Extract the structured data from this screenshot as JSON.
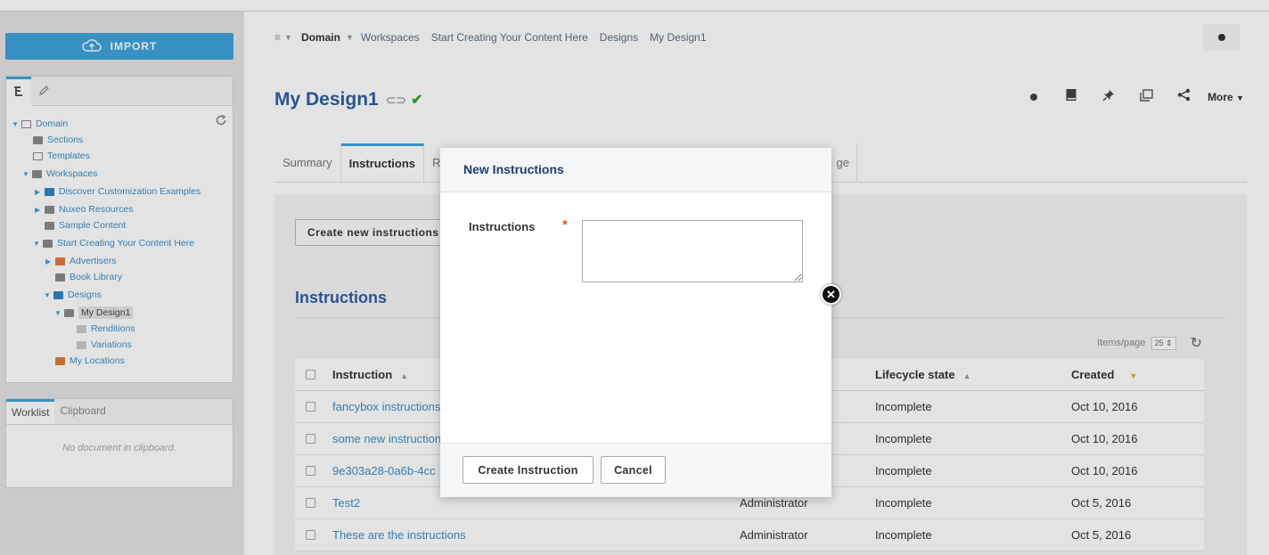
{
  "sidebar": {
    "import_label": "IMPORT",
    "tree": [
      {
        "label": "Domain",
        "icon": "database-icon"
      },
      {
        "label": "Sections",
        "icon": "folder-icon"
      },
      {
        "label": "Templates",
        "icon": "folder-outline-icon"
      },
      {
        "label": "Workspaces",
        "icon": "folder-icon"
      },
      {
        "label": "Discover Customization Examples",
        "icon": "folder-blue-icon"
      },
      {
        "label": "Nuxeo Resources",
        "icon": "folder-icon"
      },
      {
        "label": "Sample Content",
        "icon": "folder-icon"
      },
      {
        "label": "Start Creating Your Content Here",
        "icon": "folder-icon"
      },
      {
        "label": "Advertisers",
        "icon": "folder-orange-icon"
      },
      {
        "label": "Book Library",
        "icon": "library-icon"
      },
      {
        "label": "Designs",
        "icon": "folder-blue-icon"
      },
      {
        "label": "My Design1",
        "icon": "design-icon"
      },
      {
        "label": "Renditions",
        "icon": "folder-light-icon"
      },
      {
        "label": "Variations",
        "icon": "folder-light-icon"
      },
      {
        "label": "My Locations",
        "icon": "folder-orange-icon"
      }
    ],
    "clipboard_tabs": [
      "Worklist",
      "Clipboard"
    ],
    "clipboard_empty": "No document in clipboard."
  },
  "breadcrumbs": [
    "Domain",
    "Workspaces",
    "Start Creating Your Content Here",
    "Designs",
    "My Design1"
  ],
  "page": {
    "title": "My Design1",
    "more_label": "More"
  },
  "tabs": [
    "Summary",
    "Instructions",
    "R"
  ],
  "tab_hidden_label": "ge",
  "content": {
    "create_button": "Create new instructions",
    "section_title": "Instructions",
    "items_per_page_label": "Items/page",
    "items_per_page_value": "25",
    "columns": [
      "Instruction",
      "Lifecycle state",
      "Created"
    ],
    "rows": [
      {
        "instruction": "fancybox instructions",
        "author": "",
        "state": "Incomplete",
        "created": "Oct 10, 2016"
      },
      {
        "instruction": "some new instructions",
        "author": "",
        "state": "Incomplete",
        "created": "Oct 10, 2016"
      },
      {
        "instruction": "9e303a28-0a6b-4cc",
        "author": "",
        "state": "Incomplete",
        "created": "Oct 10, 2016"
      },
      {
        "instruction": "Test2",
        "author": "Administrator",
        "state": "Incomplete",
        "created": "Oct 5, 2016"
      },
      {
        "instruction": "These are the instructions",
        "author": "Administrator",
        "state": "Incomplete",
        "created": "Oct 5, 2016"
      }
    ]
  },
  "modal": {
    "title": "New Instructions",
    "field_label": "Instructions",
    "field_value": "",
    "required_mark": "*",
    "create_label": "Create Instruction",
    "cancel_label": "Cancel"
  },
  "colors": {
    "accent": "#3ea3dc",
    "title": "#2d5fa7",
    "link": "#3a8fc9",
    "required": "#d75a1a"
  }
}
